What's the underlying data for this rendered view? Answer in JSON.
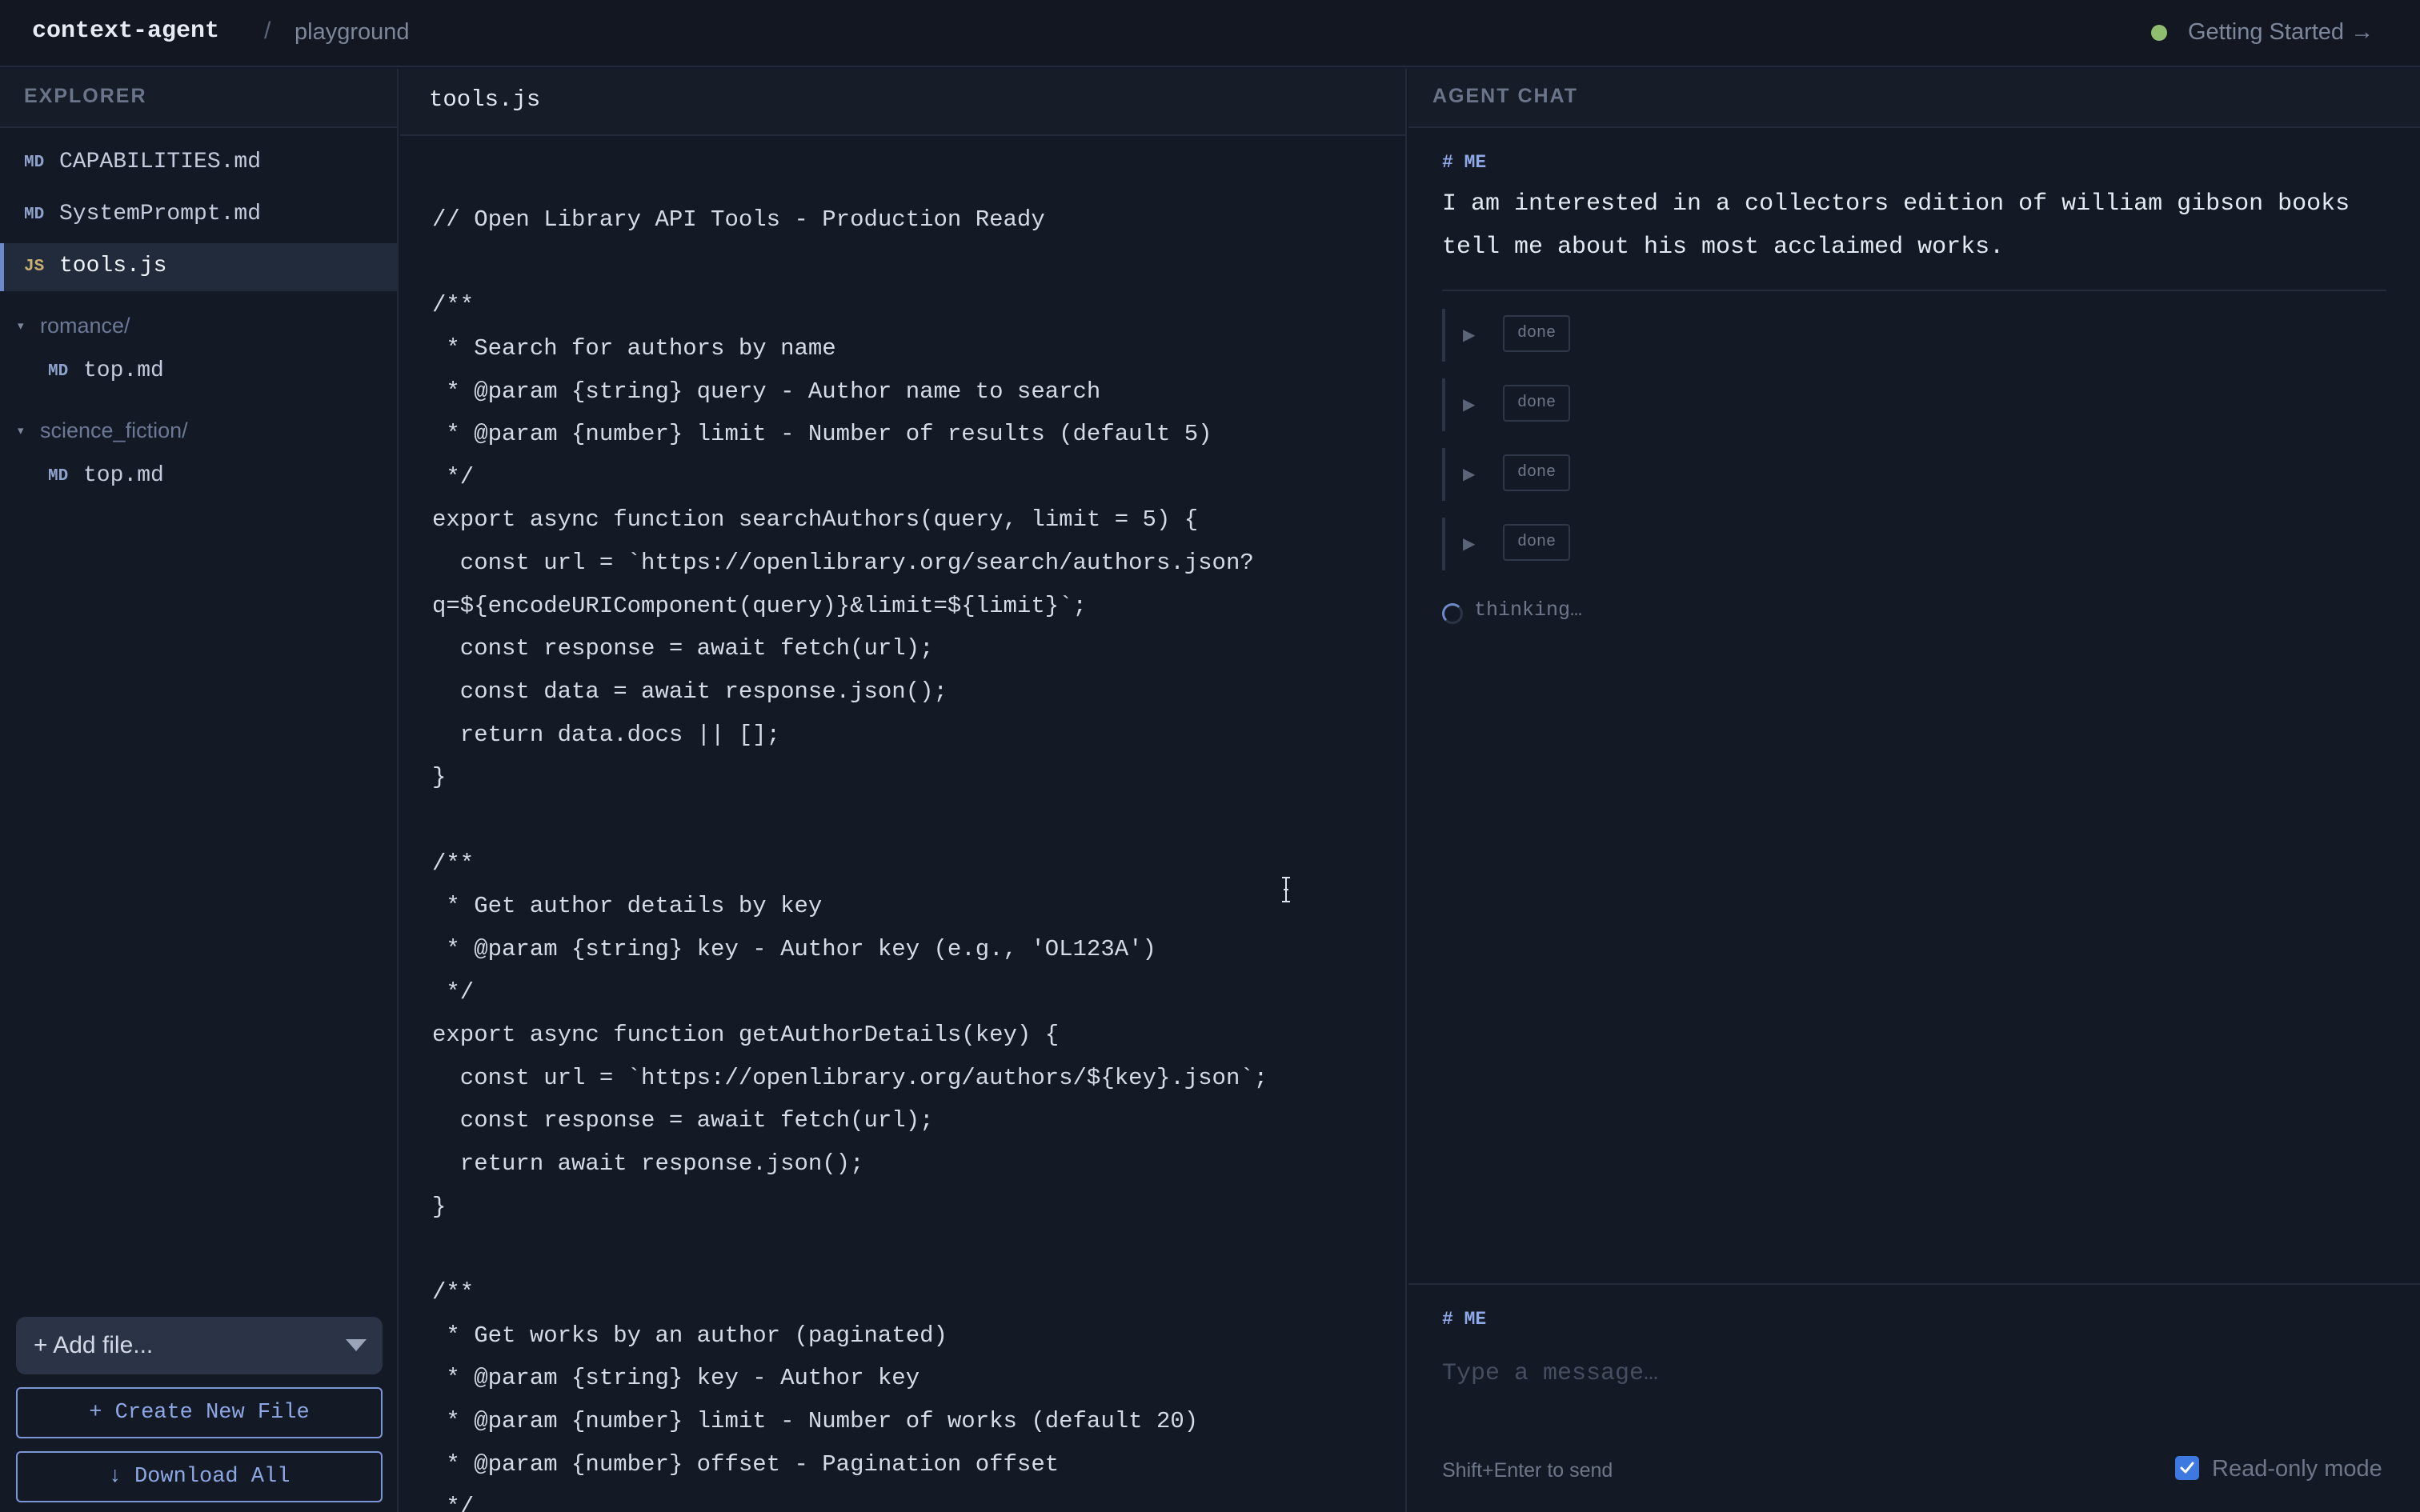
{
  "header": {
    "brand": "context-agent",
    "separator": "/",
    "crumb": "playground",
    "getting_started": "Getting Started →",
    "status_color": "#8fbc6f"
  },
  "sidebar": {
    "title": "EXPLORER",
    "files": [
      {
        "badge": "MD",
        "name": "CAPABILITIES.md"
      },
      {
        "badge": "MD",
        "name": "SystemPrompt.md"
      },
      {
        "badge": "JS",
        "name": "tools.js",
        "active": true
      }
    ],
    "folders": [
      {
        "name": "romance/",
        "files": [
          {
            "badge": "MD",
            "name": "top.md"
          }
        ]
      },
      {
        "name": "science_fiction/",
        "files": [
          {
            "badge": "MD",
            "name": "top.md"
          }
        ]
      }
    ],
    "add_file_label": "+ Add file...",
    "create_button": "+ Create New File",
    "download_button": "↓ Download All"
  },
  "editor": {
    "tab": "tools.js",
    "lines": [
      "// Open Library API Tools - Production Ready",
      "",
      "/**",
      " * Search for authors by name",
      " * @param {string} query - Author name to search",
      " * @param {number} limit - Number of results (default 5)",
      " */",
      "export async function searchAuthors(query, limit = 5) {",
      "  const url = `https://openlibrary.org/search/authors.json?",
      "q=${encodeURIComponent(query)}&limit=${limit}`;",
      "  const response = await fetch(url);",
      "  const data = await response.json();",
      "  return data.docs || [];",
      "}",
      "",
      "/**",
      " * Get author details by key",
      " * @param {string} key - Author key (e.g., 'OL123A')",
      " */",
      "export async function getAuthorDetails(key) {",
      "  const url = `https://openlibrary.org/authors/${key}.json`;",
      "  const response = await fetch(url);",
      "  return await response.json();",
      "}",
      "",
      "/**",
      " * Get works by an author (paginated)",
      " * @param {string} key - Author key",
      " * @param {number} limit - Number of works (default 20)",
      " * @param {number} offset - Pagination offset",
      " */"
    ]
  },
  "chat": {
    "title": "AGENT CHAT",
    "me_label": "# ME",
    "message": "I am interested in a collectors edition of william gibson books tell me about his most acclaimed works.",
    "steps": [
      "done",
      "done",
      "done",
      "done"
    ],
    "thinking": "thinking…",
    "composer": {
      "label": "# ME",
      "placeholder": "Type a message…",
      "hint": "Shift+Enter to send",
      "readonly_label": "Read-only mode",
      "readonly_checked": true
    }
  }
}
